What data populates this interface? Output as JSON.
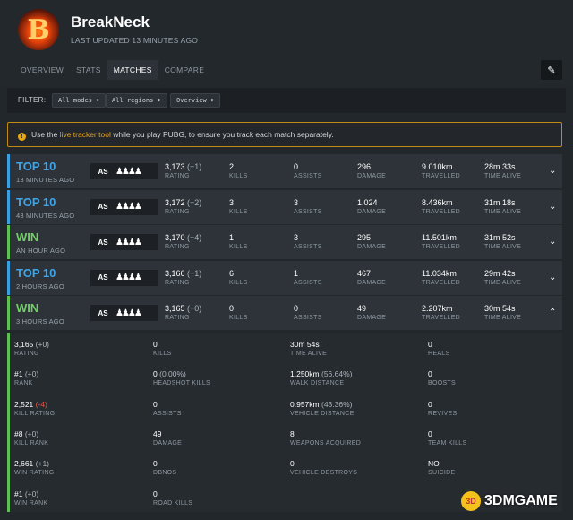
{
  "header": {
    "avatar_letter": "B",
    "player_name": "BreakNeck",
    "last_updated": "LAST UPDATED 13 MINUTES AGO",
    "tabs": [
      "OVERVIEW",
      "STATS",
      "MATCHES",
      "COMPARE"
    ],
    "active_tab": "MATCHES"
  },
  "filter": {
    "label": "FILTER:",
    "modes": "All modes ⬍",
    "regions": "All regions ⬍",
    "view": "Overview ⬍"
  },
  "notice": {
    "prefix": "Use the",
    "link": "live tracker tool",
    "suffix": "while you play PUBG, to ensure you track each match separately."
  },
  "labels": {
    "rating": "RATING",
    "kills": "KILLS",
    "assists": "ASSISTS",
    "damage": "DAMAGE",
    "travelled": "TRAVELLED",
    "time_alive": "TIME ALIVE"
  },
  "matches": [
    {
      "result": "TOP 10",
      "time": "13 MINUTES AGO",
      "region": "AS",
      "squad": "♟♟♟♟",
      "rating": "3,173",
      "rating_delta": "(+1)",
      "kills": "2",
      "assists": "0",
      "damage": "296",
      "travelled": "9.010km",
      "time_alive": "28m 33s",
      "chevron": "⌄"
    },
    {
      "result": "TOP 10",
      "time": "43 MINUTES AGO",
      "region": "AS",
      "squad": "♟♟♟♟",
      "rating": "3,172",
      "rating_delta": "(+2)",
      "kills": "3",
      "assists": "3",
      "damage": "1,024",
      "travelled": "8.436km",
      "time_alive": "31m 18s",
      "chevron": "⌄"
    },
    {
      "result": "WIN",
      "time": "AN HOUR AGO",
      "region": "AS",
      "squad": "♟♟♟♟",
      "rating": "3,170",
      "rating_delta": "(+4)",
      "kills": "1",
      "assists": "3",
      "damage": "295",
      "travelled": "11.501km",
      "time_alive": "31m 52s",
      "chevron": "⌄"
    },
    {
      "result": "TOP 10",
      "time": "2 HOURS AGO",
      "region": "AS",
      "squad": "♟♟♟♟",
      "rating": "3,166",
      "rating_delta": "(+1)",
      "kills": "6",
      "assists": "1",
      "damage": "467",
      "travelled": "11.034km",
      "time_alive": "29m 42s",
      "chevron": "⌄"
    },
    {
      "result": "WIN",
      "time": "3 HOURS AGO",
      "region": "AS",
      "squad": "♟♟♟♟",
      "rating": "3,165",
      "rating_delta": "(+0)",
      "kills": "0",
      "assists": "0",
      "damage": "49",
      "travelled": "2.207km",
      "time_alive": "30m 54s",
      "chevron": "⌃"
    }
  ],
  "details": [
    {
      "value": "3,165",
      "delta": "(+0)",
      "label": "RATING"
    },
    {
      "value": "#1",
      "delta": "(+0)",
      "label": "RANK"
    },
    {
      "value": "2,521",
      "delta": "(-4)",
      "label": "KILL RATING"
    },
    {
      "value": "#8",
      "delta": "(+0)",
      "label": "KILL RANK"
    },
    {
      "value": "2,661",
      "delta": "(+1)",
      "label": "WIN RATING"
    },
    {
      "value": "#1",
      "delta": "(+0)",
      "label": "WIN RANK"
    },
    {
      "value": "0",
      "delta": "",
      "label": "KILLS"
    },
    {
      "value": "0",
      "delta": "(0.00%)",
      "label": "HEADSHOT KILLS"
    },
    {
      "value": "0",
      "delta": "",
      "label": "ASSISTS"
    },
    {
      "value": "49",
      "delta": "",
      "label": "DAMAGE"
    },
    {
      "value": "0",
      "delta": "",
      "label": "DBNOS"
    },
    {
      "value": "0",
      "delta": "",
      "label": "ROAD KILLS"
    },
    {
      "value": "30m 54s",
      "delta": "",
      "label": "TIME ALIVE"
    },
    {
      "value": "1.250km",
      "delta": "(56.64%)",
      "label": "WALK DISTANCE"
    },
    {
      "value": "0.957km",
      "delta": "(43.36%)",
      "label": "VEHICLE DISTANCE"
    },
    {
      "value": "8",
      "delta": "",
      "label": "WEAPONS ACQUIRED"
    },
    {
      "value": "0",
      "delta": "",
      "label": "VEHICLE DESTROYS"
    },
    {
      "value": "0",
      "delta": "",
      "label": "HEALS"
    },
    {
      "value": "0",
      "delta": "",
      "label": "BOOSTS"
    },
    {
      "value": "0",
      "delta": "",
      "label": "REVIVES"
    },
    {
      "value": "0",
      "delta": "",
      "label": "TEAM KILLS"
    },
    {
      "value": "NO",
      "delta": "",
      "label": "SUICIDE"
    }
  ],
  "watermark": {
    "text": "3DMGAME",
    "icon_text": "3D"
  },
  "colors": {
    "top10": "#3ea5ea",
    "win": "#6fcf63",
    "warning": "#c18a12",
    "negative": "#e5584a"
  }
}
